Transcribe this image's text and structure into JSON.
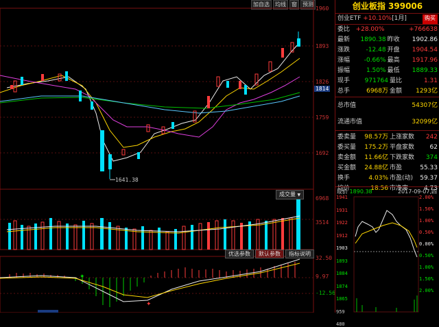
{
  "toolbar": {
    "items": [
      "加自选",
      "均线",
      "窗",
      "预测"
    ]
  },
  "kline_axis": {
    "labels": [
      "1960",
      "1893",
      "1826",
      "1814",
      "1759",
      "1692"
    ]
  },
  "kline": {
    "low_annotation": "1641.38"
  },
  "volume": {
    "tab": "成交量",
    "axis": [
      "6968",
      "3514"
    ]
  },
  "macd": {
    "tabs": [
      "优选参数",
      "默认参数",
      "指标说明"
    ],
    "active_tab": 1,
    "axis": [
      "32.50",
      "9.97",
      "-12.56"
    ]
  },
  "info": {
    "title": "创业板指 399006",
    "etf_label": "创业ETF",
    "etf_change": "+10.10%",
    "etf_period": "[1月]",
    "buy_label": "购买",
    "rows1": [
      {
        "l1": "委比",
        "v1": "+28.00%",
        "c1": "r",
        "l2": "",
        "v2": "+766638",
        "c2": "r"
      },
      {
        "l1": "最新",
        "v1": "1890.38",
        "c1": "g",
        "l2": "昨收",
        "v2": "1902.86",
        "c2": "w"
      },
      {
        "l1": "涨跌",
        "v1": "-12.48",
        "c1": "g",
        "l2": "开盘",
        "v2": "1904.54",
        "c2": "r"
      },
      {
        "l1": "涨幅",
        "v1": "-0.66%",
        "c1": "g",
        "l2": "最高",
        "v2": "1917.96",
        "c2": "r"
      },
      {
        "l1": "振幅",
        "v1": "1.50%",
        "c1": "g",
        "l2": "最低",
        "v2": "1889.33",
        "c2": "g"
      },
      {
        "l1": "现手",
        "v1": "971764",
        "c1": "g",
        "l2": "量比",
        "v2": "1.31",
        "c2": "r"
      },
      {
        "l1": "总手",
        "v1": "6968万",
        "c1": "y",
        "l2": "金额",
        "v2": "1293亿",
        "c2": "y"
      }
    ],
    "total_mv_label": "总市值",
    "total_mv": "54307亿",
    "float_mv_label": "流通市值",
    "float_mv": "32099亿",
    "rows2": [
      {
        "l1": "委卖量",
        "v1": "98.57万",
        "c1": "y",
        "l2": "上涨家数",
        "v2": "242",
        "c2": "r"
      },
      {
        "l1": "委买量",
        "v1": "175.2万",
        "c1": "y",
        "l2": "平盘家数",
        "v2": "62",
        "c2": "w"
      },
      {
        "l1": "卖金额",
        "v1": "11.66亿",
        "c1": "y",
        "l2": "下跌家数",
        "v2": "374",
        "c2": "g"
      },
      {
        "l1": "买金额",
        "v1": "24.88亿",
        "c1": "y",
        "l2": "市盈",
        "v2": "55.33",
        "c2": "w"
      },
      {
        "l1": "换手",
        "v1": "4.03%",
        "c1": "y",
        "l2": "市盈(动)",
        "v2": "59.37",
        "c2": "w"
      },
      {
        "l1": "均价",
        "v1": "18.56",
        "c1": "y",
        "l2": "市净率",
        "v2": "4.73",
        "c2": "w"
      }
    ],
    "mini": {
      "label": "现价",
      "price": "1890.38",
      "date": "2017-09-07,四",
      "left_axis": [
        "1941",
        "1931",
        "1922",
        "1912",
        "1903",
        "1893",
        "1884",
        "1874",
        "1865",
        "959",
        "480"
      ],
      "right_axis": [
        "2.00%",
        "1.50%",
        "1.00%",
        "0.50%",
        "0.00%",
        "0.50%",
        "1.00%",
        "1.50%",
        "2.00%"
      ]
    }
  }
}
